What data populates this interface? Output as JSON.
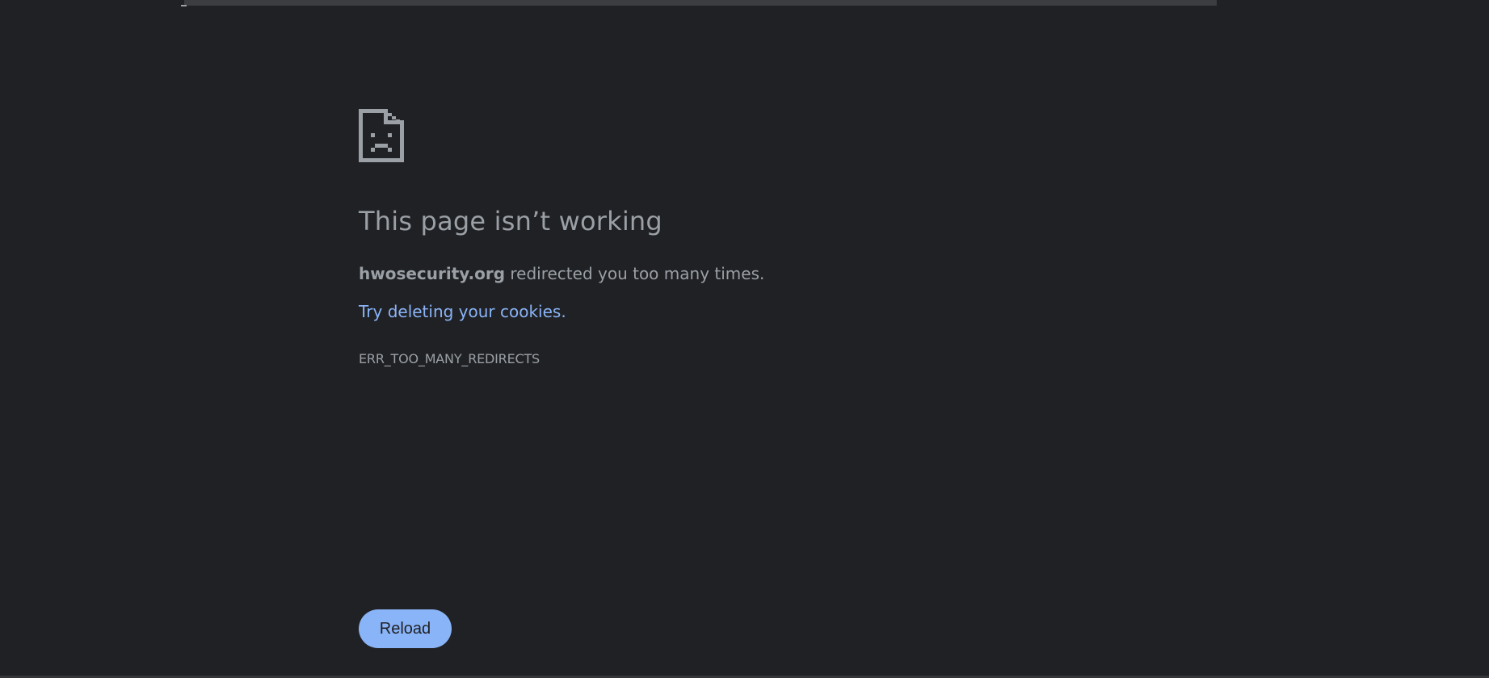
{
  "error_page": {
    "icon": "sad-document-icon",
    "headline": "This page isn’t working",
    "domain": "hwosecurity.org",
    "message_rest": " redirected you too many times.",
    "suggestion_link": "Try deleting your cookies.",
    "error_code": "ERR_TOO_MANY_REDIRECTS",
    "reload_label": "Reload"
  },
  "colors": {
    "background": "#202124",
    "text": "#9aa0a6",
    "link": "#8ab4f8",
    "button": "#8ab4f8"
  }
}
